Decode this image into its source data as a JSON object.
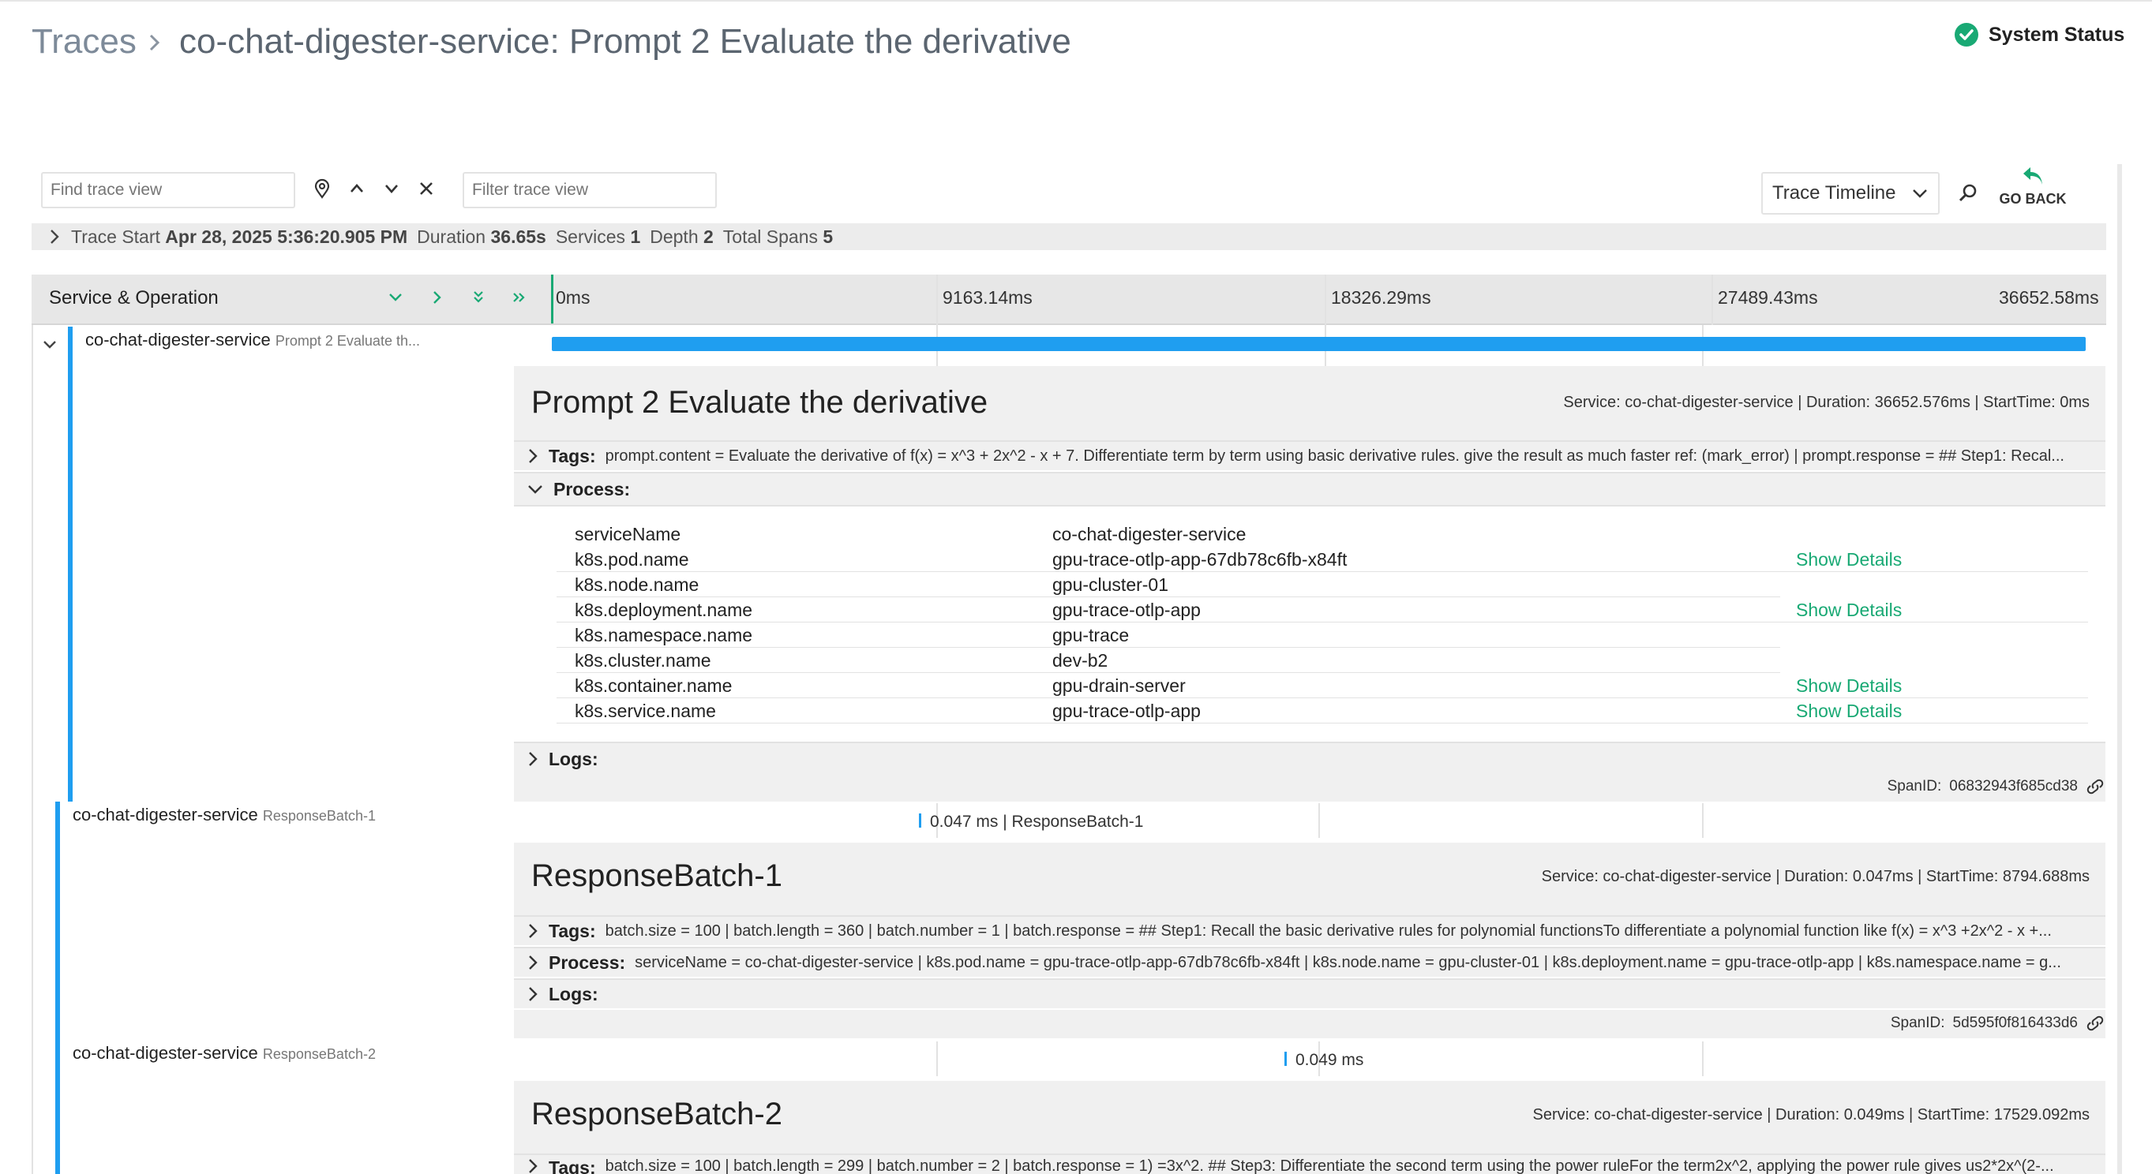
{
  "header": {
    "breadcrumb_root": "Traces",
    "title": "co-chat-digester-service: Prompt 2 Evaluate the derivative",
    "system_status": "System Status"
  },
  "toolbar": {
    "find_placeholder": "Find trace view",
    "filter_placeholder": "Filter trace view",
    "view_select": "Trace Timeline",
    "go_back": "GO BACK"
  },
  "summary": {
    "trace_start_label": "Trace Start",
    "trace_start": "Apr 28, 2025 5:36:20.905 PM",
    "duration_label": "Duration",
    "duration": "36.65s",
    "services_label": "Services",
    "services": "1",
    "depth_label": "Depth",
    "depth": "2",
    "total_spans_label": "Total Spans",
    "total_spans": "5"
  },
  "timeline": {
    "column_header": "Service & Operation",
    "ticks": [
      "0ms",
      "9163.14ms",
      "18326.29ms",
      "27489.43ms",
      "36652.58ms"
    ]
  },
  "spans": [
    {
      "service": "co-chat-digester-service",
      "operation": "Prompt 2 Evaluate th...",
      "title": "Prompt 2 Evaluate the derivative",
      "meta": "Service: co-chat-digester-service | Duration: 36652.576ms | StartTime: 0ms",
      "tags_label": "Tags:",
      "tags": "prompt.content = Evaluate the derivative of f(x) = x^3 + 2x^2 - x + 7. Differentiate term by term using basic derivative rules. give the result as much faster ref: (mark_error) | prompt.response = ## Step1: Recal...",
      "process_label": "Process:",
      "logs_label": "Logs:",
      "spanid_label": "SpanID:",
      "spanid": "06832943f685cd38",
      "process": [
        {
          "key": "serviceName",
          "value": "co-chat-digester-service",
          "action": ""
        },
        {
          "key": "k8s.pod.name",
          "value": "gpu-trace-otlp-app-67db78c6fb-x84ft",
          "action": "Show Details"
        },
        {
          "key": "k8s.node.name",
          "value": "gpu-cluster-01",
          "action": ""
        },
        {
          "key": "k8s.deployment.name",
          "value": "gpu-trace-otlp-app",
          "action": "Show Details"
        },
        {
          "key": "k8s.namespace.name",
          "value": "gpu-trace",
          "action": ""
        },
        {
          "key": "k8s.cluster.name",
          "value": "dev-b2",
          "action": ""
        },
        {
          "key": "k8s.container.name",
          "value": "gpu-drain-server",
          "action": "Show Details"
        },
        {
          "key": "k8s.service.name",
          "value": "gpu-trace-otlp-app",
          "action": "Show Details"
        }
      ]
    },
    {
      "service": "co-chat-digester-service",
      "operation": "ResponseBatch-1",
      "bar_label": "0.047 ms | ResponseBatch-1",
      "title": "ResponseBatch-1",
      "meta": "Service: co-chat-digester-service | Duration: 0.047ms | StartTime: 8794.688ms",
      "tags_label": "Tags:",
      "tags": "batch.size = 100 | batch.length = 360 | batch.number = 1 | batch.response = ## Step1: Recall the basic derivative rules for polynomial functionsTo differentiate a polynomial function like f(x) = x^3 +2x^2 - x +...",
      "process_label": "Process:",
      "process_inline": "serviceName = co-chat-digester-service | k8s.pod.name = gpu-trace-otlp-app-67db78c6fb-x84ft | k8s.node.name = gpu-cluster-01 | k8s.deployment.name = gpu-trace-otlp-app | k8s.namespace.name = g...",
      "logs_label": "Logs:",
      "spanid_label": "SpanID:",
      "spanid": "5d595f0f816433d6"
    },
    {
      "service": "co-chat-digester-service",
      "operation": "ResponseBatch-2",
      "bar_label": "0.049 ms",
      "title": "ResponseBatch-2",
      "meta": "Service: co-chat-digester-service | Duration: 0.049ms | StartTime: 17529.092ms",
      "tags_label": "Tags:",
      "tags": "batch.size = 100 | batch.length = 299 | batch.number = 2 | batch.response = 1) =3x^2. ## Step3: Differentiate the second term using the power ruleFor the term2x^2, applying the power rule gives us2*2x^(2-..."
    }
  ],
  "colors": {
    "accent": "#1f9ef0",
    "link": "#19a974",
    "status_ok": "#19a974"
  }
}
